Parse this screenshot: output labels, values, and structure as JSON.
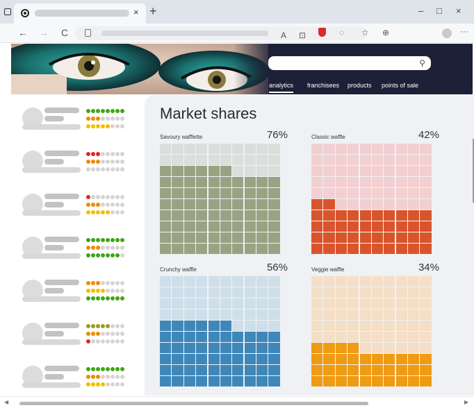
{
  "browser": {
    "tab_close": "×",
    "new_tab": "+",
    "minimize": "–",
    "maximize": "□",
    "close": "×",
    "back": "←",
    "forward": "→",
    "reload": "C",
    "more": "···"
  },
  "site": {
    "nav": [
      "analytics",
      "franchisees",
      "products",
      "points of sale"
    ],
    "active_nav": "analytics"
  },
  "main": {
    "title": "Market shares",
    "panels": [
      {
        "name": "Savoury wafflette",
        "percent_label": "76%",
        "share": 76,
        "filled_color": "#99a383",
        "empty_color": "#dcdedb"
      },
      {
        "name": "Classic waffle",
        "percent_label": "42%",
        "share": 42,
        "filled_color": "#d9542b",
        "empty_color": "#f2cfd0"
      },
      {
        "name": "Crunchy waffle",
        "percent_label": "56%",
        "share": 56,
        "filled_color": "#3f87b8",
        "empty_color": "#cfdfea"
      },
      {
        "name": "Veggie waffle",
        "percent_label": "34%",
        "share": 34,
        "filled_color": "#ef9b13",
        "empty_color": "#f4dfc6"
      }
    ]
  },
  "sidebar": {
    "colors": {
      "green": "#3ea616",
      "orange": "#f08a00",
      "red": "#e1261c",
      "yellow": "#f2bd00",
      "olive": "#9a9e1b",
      "empty": "#d4d4d4"
    },
    "items": [
      {
        "rows": [
          {
            "color": "green",
            "filled": 8
          },
          {
            "color": "orange",
            "filled": 3,
            "extra": "red"
          },
          {
            "color": "yellow",
            "filled": 5
          }
        ]
      },
      {
        "rows": [
          {
            "color": "red",
            "filled": 3
          },
          {
            "color": "orange",
            "filled": 3
          },
          {
            "color": "empty",
            "filled": 0
          }
        ]
      },
      {
        "rows": [
          {
            "color": "red",
            "filled": 1
          },
          {
            "color": "orange",
            "filled": 3
          },
          {
            "color": "yellow",
            "filled": 5
          }
        ]
      },
      {
        "rows": [
          {
            "color": "green",
            "filled": 8
          },
          {
            "color": "orange",
            "filled": 3
          },
          {
            "color": "green",
            "filled": 7
          }
        ]
      },
      {
        "rows": [
          {
            "color": "orange",
            "filled": 3
          },
          {
            "color": "yellow",
            "filled": 4
          },
          {
            "color": "green",
            "filled": 8
          }
        ]
      },
      {
        "rows": [
          {
            "color": "olive",
            "filled": 5
          },
          {
            "color": "orange",
            "filled": 3
          },
          {
            "color": "red",
            "filled": 1
          }
        ]
      },
      {
        "rows": [
          {
            "color": "green",
            "filled": 8
          },
          {
            "color": "orange",
            "filled": 3
          },
          {
            "color": "yellow",
            "filled": 4
          }
        ]
      }
    ]
  }
}
